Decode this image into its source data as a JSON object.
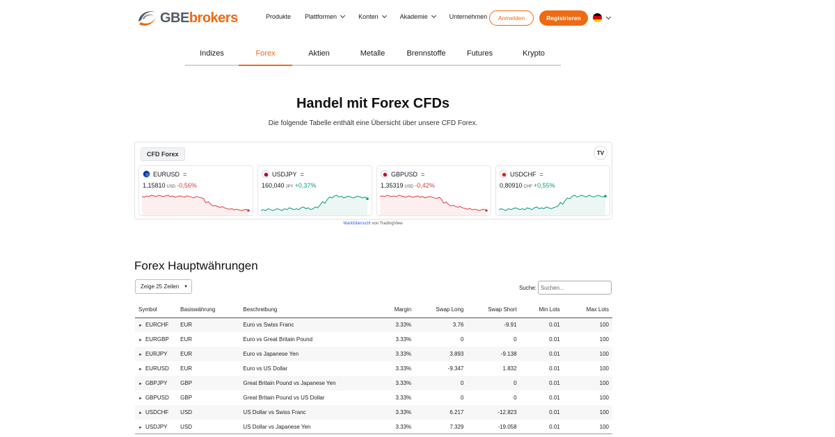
{
  "brand": {
    "part1": "GBE",
    "part2": "brokers",
    "accent": "#ef6a12"
  },
  "nav": {
    "items": [
      {
        "label": "Produkte",
        "dropdown": false
      },
      {
        "label": "Plattformen",
        "dropdown": true
      },
      {
        "label": "Konten",
        "dropdown": true
      },
      {
        "label": "Akademie",
        "dropdown": true
      },
      {
        "label": "Unternehmen",
        "dropdown": true
      }
    ],
    "login": "Anmelden",
    "register": "Registrieren",
    "language_icon": "germany-flag-icon"
  },
  "tabs": [
    {
      "label": "Indizes",
      "active": false
    },
    {
      "label": "Forex",
      "active": true
    },
    {
      "label": "Aktien",
      "active": false
    },
    {
      "label": "Metalle",
      "active": false
    },
    {
      "label": "Brennstoffe",
      "active": false
    },
    {
      "label": "Futures",
      "active": false
    },
    {
      "label": "Krypto",
      "active": false
    }
  ],
  "hero": {
    "title": "Handel mit Forex CFDs",
    "subtitle": "Die folgende Tabelle enthält eine Übersicht über unsere CFD Forex."
  },
  "widget": {
    "tab": "CFD Forex",
    "tv_logo": "TV",
    "cards": [
      {
        "symbol": "EURUSD",
        "price": "1,15810",
        "currency": "USD",
        "change": "-0,56%",
        "direction": "down",
        "color": "#e0393e",
        "series": [
          80,
          79,
          81,
          80,
          82,
          81,
          80,
          82,
          81,
          80,
          81,
          82,
          80,
          81,
          79,
          80,
          81,
          80,
          79,
          81,
          80,
          79,
          78,
          80,
          79,
          78,
          77,
          70,
          72,
          68,
          65,
          66,
          64,
          63,
          64,
          62,
          61,
          60,
          61,
          59,
          60,
          59,
          58,
          59,
          60,
          58
        ]
      },
      {
        "symbol": "USDJPY",
        "price": "160,040",
        "currency": "JPY",
        "change": "+0,37%",
        "direction": "up",
        "color": "#089981",
        "series": [
          40,
          41,
          40,
          42,
          41,
          40,
          41,
          42,
          41,
          40,
          42,
          41,
          43,
          42,
          41,
          42,
          41,
          43,
          44,
          42,
          43,
          41,
          42,
          44,
          43,
          46,
          50,
          48,
          52,
          55,
          54,
          56,
          57,
          55,
          56,
          54,
          55,
          56,
          55,
          54,
          55,
          56,
          55,
          54,
          55,
          53
        ]
      },
      {
        "symbol": "GBPUSD",
        "price": "1,35319",
        "currency": "USD",
        "change": "-0,42%",
        "direction": "down",
        "color": "#e0393e",
        "series": [
          80,
          81,
          80,
          82,
          81,
          80,
          81,
          80,
          82,
          81,
          80,
          79,
          81,
          80,
          79,
          80,
          81,
          79,
          80,
          78,
          79,
          80,
          79,
          78,
          77,
          79,
          76,
          70,
          72,
          68,
          66,
          67,
          65,
          64,
          65,
          63,
          62,
          61,
          62,
          60,
          61,
          60,
          59,
          60,
          61,
          59
        ]
      },
      {
        "symbol": "USDCHF",
        "price": "0,80910",
        "currency": "CHF",
        "change": "+0,55%",
        "direction": "up",
        "color": "#089981",
        "series": [
          40,
          41,
          40,
          39,
          41,
          40,
          41,
          42,
          41,
          40,
          41,
          40,
          42,
          41,
          40,
          42,
          43,
          41,
          42,
          41,
          43,
          42,
          41,
          42,
          43,
          44,
          48,
          46,
          50,
          53,
          52,
          55,
          56,
          54,
          55,
          56,
          55,
          54,
          56,
          55,
          54,
          55,
          56,
          55,
          54,
          55
        ]
      }
    ],
    "attribution_link": "Marktübersicht",
    "attribution_rest": " von TradingView"
  },
  "table": {
    "title": "Forex Hauptwährungen",
    "length_select": "Zeige 25 Zeilen",
    "search_label": "Suche:",
    "search_placeholder": "Suchen...",
    "headers": [
      "Symbol",
      "Basiswährung",
      "Beschreibung",
      "Margin",
      "Swap Long",
      "Swap Short",
      "Min Lots",
      "Max Lots"
    ],
    "rows": [
      [
        "EURCHF",
        "EUR",
        "Euro vs Swiss Franc",
        "3.33%",
        "3.76",
        "-9.91",
        "0.01",
        "100"
      ],
      [
        "EURGBP",
        "EUR",
        "Euro vs Great Britain Pound",
        "3.33%",
        "0",
        "0",
        "0.01",
        "100"
      ],
      [
        "EURJPY",
        "EUR",
        "Euro vs Japanese Yen",
        "3.33%",
        "3.893",
        "-9.138",
        "0.01",
        "100"
      ],
      [
        "EURUSD",
        "EUR",
        "Euro vs US Dollar",
        "3.33%",
        "-9.347",
        "1.832",
        "0.01",
        "100"
      ],
      [
        "GBPJPY",
        "GBP",
        "Great Britain Pound vs Japanese Yen",
        "3.33%",
        "0",
        "0",
        "0.01",
        "100"
      ],
      [
        "GBPUSD",
        "GBP",
        "Great Britain Pound vs US Dollar",
        "3.33%",
        "0",
        "0",
        "0.01",
        "100"
      ],
      [
        "USDCHF",
        "USD",
        "US Dollar vs Swiss Franc",
        "3.33%",
        "6.217",
        "-12.823",
        "0.01",
        "100"
      ],
      [
        "USDJPY",
        "USD",
        "US Dollar vs Japanese Yen",
        "3.33%",
        "7.329",
        "-19.058",
        "0.01",
        "100"
      ]
    ]
  }
}
